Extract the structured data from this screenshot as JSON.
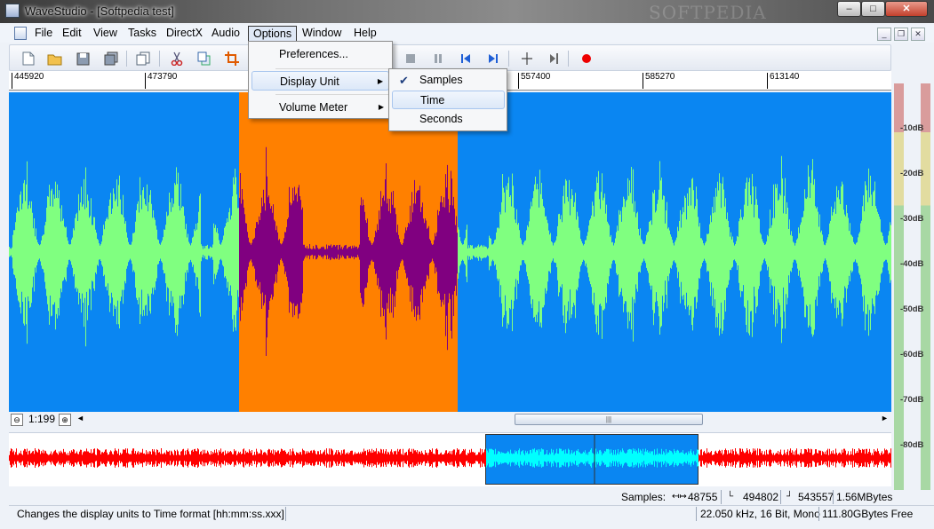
{
  "window": {
    "title": "WaveStudio - [Softpedia test]",
    "watermark": "SOFTPEDIA"
  },
  "menubar": {
    "items": [
      "File",
      "Edit",
      "View",
      "Tasks",
      "DirectX",
      "Audio",
      "Options",
      "Window",
      "Help"
    ],
    "active": "Options"
  },
  "options_menu": {
    "items": [
      {
        "label": "Preferences...",
        "submenu": false
      },
      {
        "label": "Display Unit",
        "submenu": true
      },
      {
        "label": "Volume Meter",
        "submenu": true
      }
    ]
  },
  "display_unit_menu": {
    "items": [
      {
        "label": "Samples",
        "checked": true
      },
      {
        "label": "Time",
        "highlighted": true
      },
      {
        "label": "Seconds"
      }
    ]
  },
  "toolbar": {
    "icons": [
      "new-icon",
      "open-icon",
      "save-icon",
      "save-all-icon",
      "copy-doc-icon",
      "cut-icon",
      "copy-icon",
      "crop-icon",
      "stop-icon",
      "pause-icon",
      "skip-start-icon",
      "skip-end-icon",
      "marker-icon",
      "goto-marker-icon",
      "record-icon"
    ]
  },
  "ruler": {
    "ticks": [
      "445920",
      "473790",
      "557400",
      "585270",
      "613140"
    ]
  },
  "zoom": {
    "label": "1:199"
  },
  "meter": {
    "labels": [
      "-10dB",
      "-20dB",
      "-30dB",
      "-40dB",
      "-50dB",
      "-60dB",
      "-70dB",
      "-80dB"
    ]
  },
  "status": {
    "samples_label": "Samples:",
    "length": "48755",
    "start": "494802",
    "end": "543557",
    "size": "1.56MBytes",
    "hint": "Changes the display units to Time format [hh:mm:ss.xxx]",
    "format": "22.050 kHz, 16 Bit, Mono",
    "free": "111.80GBytes Free"
  },
  "colors": {
    "wave_bg": "#0a86f2",
    "selection": "#ff8000",
    "waveform": "#80ff80",
    "waveform_selected": "#800080",
    "overview_wave": "#ff0000",
    "overview_selected": "#00ffff"
  }
}
